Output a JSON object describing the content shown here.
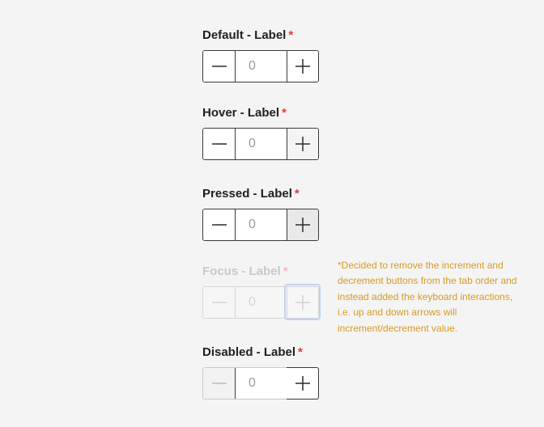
{
  "steppers": [
    {
      "label": "Default - Label",
      "required_mark": "*",
      "value": "0"
    },
    {
      "label": "Hover - Label",
      "required_mark": "*",
      "value": "0"
    },
    {
      "label": "Pressed - Label",
      "required_mark": "*",
      "value": "0"
    },
    {
      "label": "Focus - Label",
      "required_mark": "*",
      "value": "0"
    },
    {
      "label": "Disabled - Label",
      "required_mark": "*",
      "value": "0"
    }
  ],
  "note": "*Decided to remove the increment and decrement buttons from the tab order and instead added the keyboard interactions, i.e. up and down arrows will increment/decrement value.",
  "icons": {
    "decrement": "minus-icon",
    "increment": "plus-icon"
  },
  "colors": {
    "required": "#e0393e",
    "note": "#d89a20",
    "focus_ring": "#bcd4f3"
  }
}
